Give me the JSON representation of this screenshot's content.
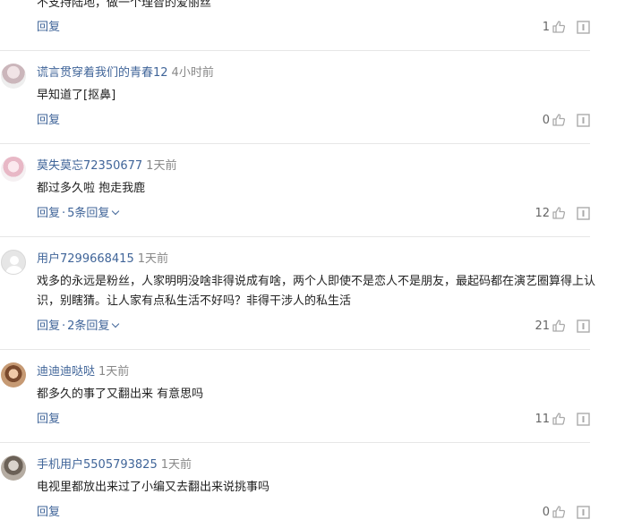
{
  "comments": [
    {
      "content": "不支持陆地，做一个理智的爱丽丝",
      "reply_label": "回复",
      "likes": "1"
    },
    {
      "username": "谎言贯穿着我们的青春12",
      "time": "4小时前",
      "content": "早知道了[抠鼻]",
      "reply_label": "回复",
      "likes": "0"
    },
    {
      "username": "莫失莫忘72350677",
      "time": "1天前",
      "content": "都过多久啦 抱走我鹿",
      "reply_label": "回复",
      "separator": "·",
      "more_replies": "5条回复",
      "likes": "12"
    },
    {
      "username": "用户7299668415",
      "time": "1天前",
      "content": "戏多的永远是粉丝，人家明明没啥非得说成有啥，两个人即使不是恋人不是朋友，最起码都在演艺圈算得上认识，别瞎猜。让人家有点私生活不好吗？非得干涉人的私生活",
      "reply_label": "回复",
      "separator": "·",
      "more_replies": "2条回复",
      "likes": "21"
    },
    {
      "username": "迪迪迪哒哒",
      "time": "1天前",
      "content": "都多久的事了又翻出来 有意思吗",
      "reply_label": "回复",
      "likes": "11"
    },
    {
      "username": "手机用户5505793825",
      "time": "1天前",
      "content": "电视里都放出来过了小编又去翻出来说挑事吗",
      "reply_label": "回复",
      "likes": "0"
    }
  ],
  "colors": {
    "link": "#406599",
    "time": "#888888",
    "text": "#222222",
    "icon": "#aaaaaa",
    "divider": "#e6e6e6"
  },
  "icons": {
    "like": "thumbs-up-icon",
    "report": "report-icon"
  }
}
